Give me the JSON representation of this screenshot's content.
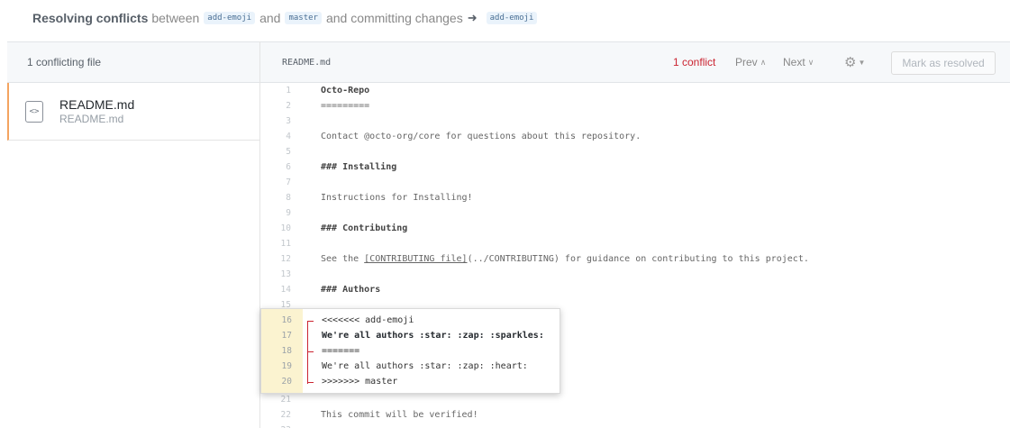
{
  "header": {
    "title_strong": "Resolving conflicts",
    "between": "between",
    "branch_a": "add-emoji",
    "and": "and",
    "branch_b": "master",
    "committing": "and committing changes",
    "arrow": "➜",
    "target_branch": "add-emoji"
  },
  "sidebar": {
    "header": "1 conflicting file",
    "file": {
      "icon": "<>",
      "icon_name": "file-code-icon",
      "name": "README.md",
      "path": "README.md"
    }
  },
  "editor": {
    "filename": "README.md",
    "conflict_count": "1 conflict",
    "prev": "Prev",
    "next": "Next",
    "mark_resolved": "Mark as resolved",
    "gear_icon": "gear-icon",
    "conflict_color": "#cb2431",
    "accent_color": "#f4a460"
  },
  "code_lines": [
    {
      "n": "1",
      "text": "Octo-Repo",
      "style": "heading"
    },
    {
      "n": "2",
      "text": "=========",
      "style": "normal"
    },
    {
      "n": "3",
      "text": "",
      "style": "normal"
    },
    {
      "n": "4",
      "text": "Contact @octo-org/core for questions about this repository.",
      "style": "normal"
    },
    {
      "n": "5",
      "text": "",
      "style": "normal"
    },
    {
      "n": "6",
      "text": "### Installing",
      "style": "heading"
    },
    {
      "n": "7",
      "text": "",
      "style": "normal"
    },
    {
      "n": "8",
      "text": "Instructions for Installing!",
      "style": "normal"
    },
    {
      "n": "9",
      "text": "",
      "style": "normal"
    },
    {
      "n": "10",
      "text": "### Contributing",
      "style": "heading"
    },
    {
      "n": "11",
      "text": "",
      "style": "normal"
    },
    {
      "n": "12",
      "text_before": "See the ",
      "link": "[CONTRIBUTING file]",
      "text_after": "(../CONTRIBUTING) for guidance on contributing to this project.",
      "style": "normal"
    },
    {
      "n": "13",
      "text": "",
      "style": "normal"
    },
    {
      "n": "14",
      "text": "### Authors",
      "style": "heading"
    },
    {
      "n": "15",
      "text": "",
      "style": "normal"
    }
  ],
  "conflict_lines": [
    {
      "n": "16",
      "text": "<<<<<<< add-emoji",
      "style": "marker"
    },
    {
      "n": "17",
      "text": "We're all authors :star: :zap: :sparkles:",
      "style": "ours"
    },
    {
      "n": "18",
      "text": "=======",
      "style": "marker"
    },
    {
      "n": "19",
      "text": "We're all authors :star: :zap: :heart:",
      "style": "theirs"
    },
    {
      "n": "20",
      "text": ">>>>>>> master",
      "style": "marker"
    }
  ],
  "code_after": [
    {
      "n": "21",
      "text": "",
      "style": "normal"
    },
    {
      "n": "22",
      "text": "This commit will be verified!",
      "style": "normal"
    },
    {
      "n": "23",
      "text": "",
      "style": "normal"
    }
  ]
}
